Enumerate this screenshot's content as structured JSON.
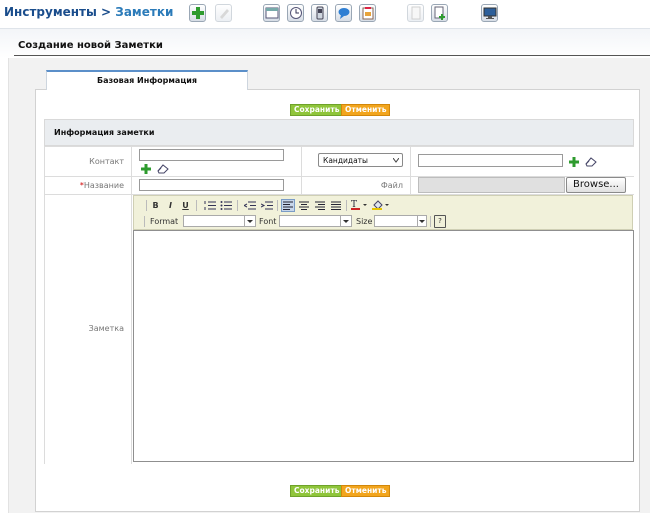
{
  "breadcrumb": {
    "section": "Инструменты",
    "separator": ">",
    "current": "Заметки"
  },
  "toolbar_icons": [
    "add-icon",
    "edit-disabled-icon",
    "calendar-window-icon",
    "clock-icon",
    "mobile-phone-icon",
    "chat-bubble-icon",
    "clipboard-icon",
    "document-disabled-icon",
    "document-add-icon",
    "monitor-icon"
  ],
  "page": {
    "title": "Создание новой Заметки"
  },
  "tabs": [
    {
      "label": "Базовая Информация",
      "active": true
    }
  ],
  "actions": {
    "save_label": "Сохранить",
    "cancel_label": "Отменить",
    "save_color": "#8fc53a",
    "cancel_color": "#f2a51d"
  },
  "section": {
    "title": "Информация заметки"
  },
  "form": {
    "contact_label": "Контакт",
    "contact_value": "",
    "contact_type_selected": "Кандидаты",
    "contact_search_value": "",
    "name_required_mark": "*",
    "name_label": "Название",
    "name_value": "",
    "file_label": "Файл",
    "browse_label": "Browse...",
    "note_label": "Заметка"
  },
  "editor": {
    "buttons": [
      "B",
      "I",
      "U"
    ],
    "format_label": "Format",
    "font_label": "Font",
    "size_label": "Size",
    "format_value": "",
    "font_value": "",
    "size_value": "",
    "help_glyph": "?",
    "content": ""
  },
  "colors": {
    "breadcrumb": "#1a4d8c",
    "required": "#d00000",
    "tab_accent": "#5b8fc9",
    "toolbar_bg": "#f1f1da"
  }
}
